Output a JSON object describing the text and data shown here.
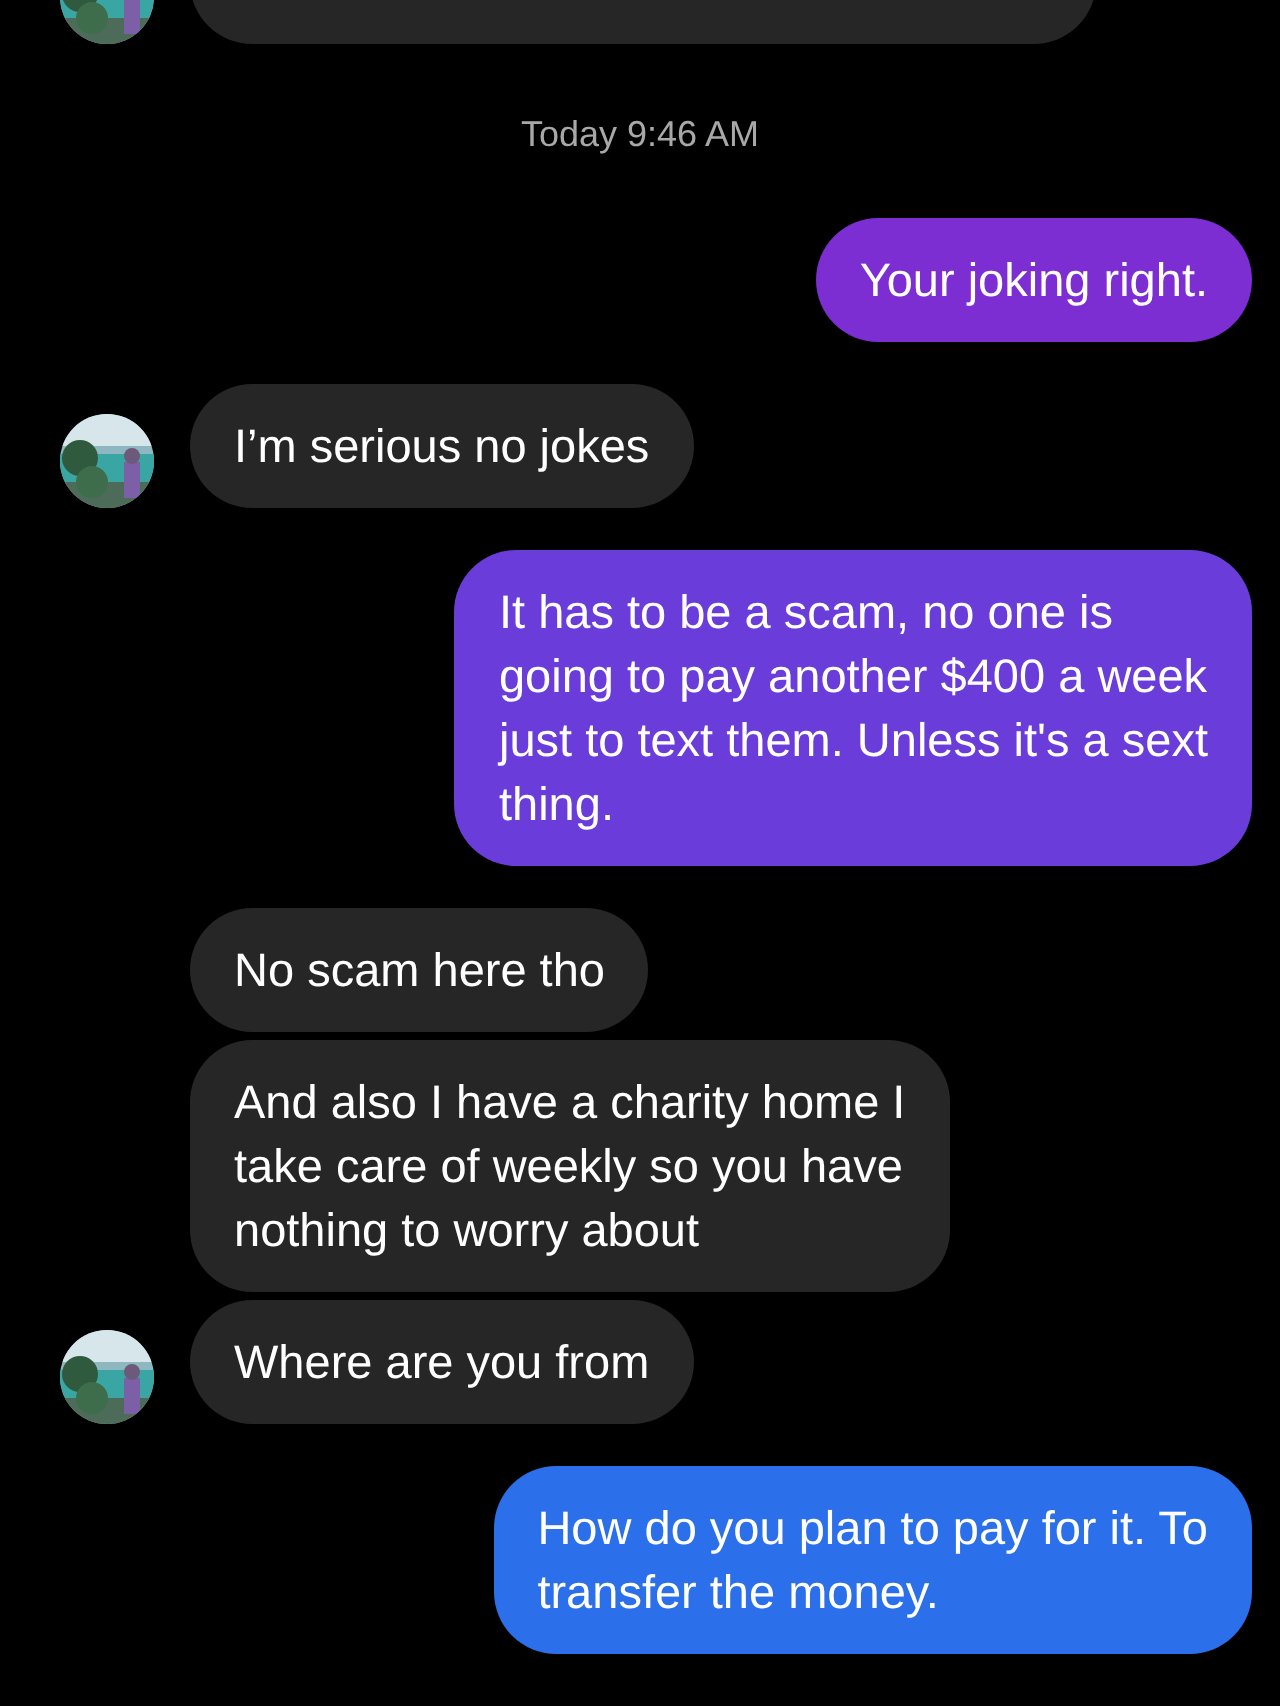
{
  "messages": [
    {
      "kind": "cut_incoming",
      "avatar": true
    },
    {
      "kind": "timestamp",
      "text": "Today 9:46 AM"
    },
    {
      "kind": "outgoing",
      "text": "Your joking right.",
      "color": "#7c2ed2"
    },
    {
      "kind": "incoming",
      "avatar": true,
      "text": "I’m serious no jokes"
    },
    {
      "kind": "outgoing",
      "text": "It has to be a scam, no one is\ngoing to pay another $400 a week\njust to text them. Unless it's a sext\nthing.",
      "color": "#6a3cda"
    },
    {
      "kind": "incoming",
      "avatar": false,
      "text": "No scam here tho"
    },
    {
      "kind": "incoming",
      "avatar": false,
      "text": "And also I have a charity home I\ntake care of weekly so you have\nnothing to worry about"
    },
    {
      "kind": "incoming",
      "avatar": true,
      "text": "Where are you from"
    },
    {
      "kind": "outgoing",
      "text": "How do you plan to pay for it. To\ntransfer the money.",
      "color": "#2b6fea"
    }
  ]
}
